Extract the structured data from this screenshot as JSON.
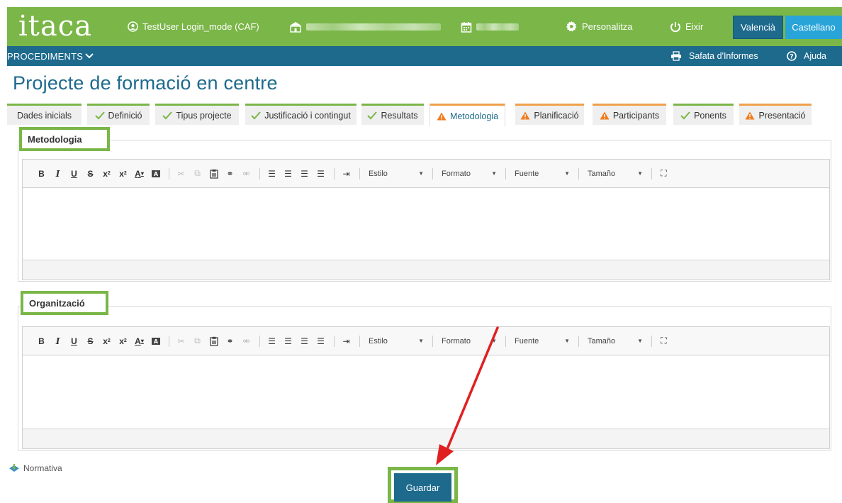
{
  "header": {
    "logo": "itaca",
    "user": "TestUser Login_mode (CAF)",
    "personalize": "Personalitza",
    "exit": "Eixir",
    "lang_valencia": "Valencià",
    "lang_castellano": "Castellano"
  },
  "nav": {
    "procediments": "PROCEDIMENTS",
    "reports": "Safata d'Informes",
    "help": "Ajuda"
  },
  "page": {
    "title": "Projecte de formació en centre"
  },
  "tabs": [
    {
      "label": "Dades inicials",
      "status": "none"
    },
    {
      "label": "Definició",
      "status": "ok"
    },
    {
      "label": "Tipus projecte",
      "status": "ok"
    },
    {
      "label": "Justificació i contingut",
      "status": "ok"
    },
    {
      "label": "Resultats",
      "status": "ok"
    },
    {
      "label": "Metodologia",
      "status": "warn"
    },
    {
      "label": "Planificació",
      "status": "warn"
    },
    {
      "label": "Participants",
      "status": "warn"
    },
    {
      "label": "Ponents",
      "status": "ok"
    },
    {
      "label": "Presentació",
      "status": "warn"
    }
  ],
  "sections": {
    "metodologia": "Metodologia",
    "organitzacio": "Organització"
  },
  "editor": {
    "estilo": "Estilo",
    "formato": "Formato",
    "fuente": "Fuente",
    "tamano": "Tamaño"
  },
  "footer": {
    "normativa": "Normativa",
    "save": "Guardar"
  },
  "colors": {
    "green": "#7ab648",
    "blue": "#1d6a8d",
    "light_blue": "#28a4d8",
    "orange": "#f0a04b",
    "arrow_red": "#e02020"
  }
}
